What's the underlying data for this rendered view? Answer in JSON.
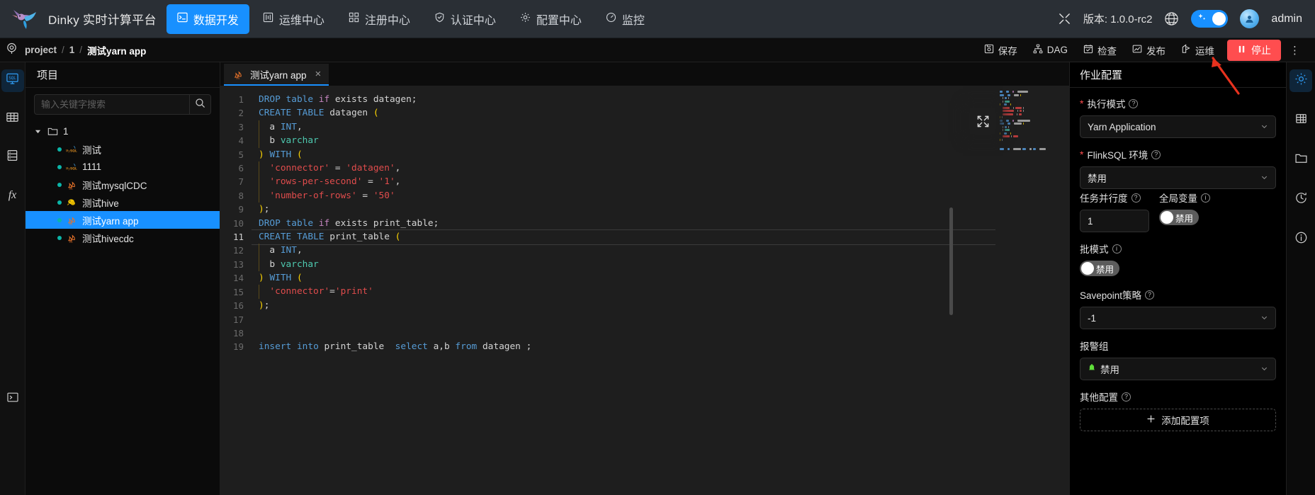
{
  "topnav": {
    "brand": "Dinky 实时计算平台",
    "items": [
      {
        "label": "数据开发",
        "icon": "sql-terminal-icon",
        "active": true
      },
      {
        "label": "运维中心",
        "icon": "ops-icon",
        "active": false
      },
      {
        "label": "注册中心",
        "icon": "registry-icon",
        "active": false
      },
      {
        "label": "认证中心",
        "icon": "auth-shield-icon",
        "active": false
      },
      {
        "label": "配置中心",
        "icon": "gear-icon",
        "active": false
      },
      {
        "label": "监控",
        "icon": "monitor-gauge-icon",
        "active": false
      }
    ],
    "expand_icon": "fullscreen-icon",
    "version": "版本: 1.0.0-rc2",
    "globe_icon": "globe-icon",
    "theme_toggle": "theme-toggle",
    "avatar_icon": "user-avatar",
    "username": "admin"
  },
  "toolbar": {
    "location_icon": "location-pin-icon",
    "breadcrumb": {
      "root": "project",
      "level1": "1",
      "current": "测试yarn app",
      "sep": "/"
    },
    "buttons": [
      {
        "label": "保存",
        "icon": "save-icon"
      },
      {
        "label": "DAG",
        "icon": "dag-icon"
      },
      {
        "label": "检查",
        "icon": "check-icon"
      },
      {
        "label": "发布",
        "icon": "publish-chart-icon"
      },
      {
        "label": "运维",
        "icon": "ops-flag-icon"
      }
    ],
    "stop_label": "停止",
    "stop_icon": "pause-icon",
    "stop_color": "#ff4d4f",
    "more_icon": "more-vertical-icon"
  },
  "left_rail": {
    "items": [
      {
        "icon": "sql-console-icon",
        "active": true
      },
      {
        "icon": "table-grid-icon",
        "active": false
      },
      {
        "icon": "database-icon",
        "active": false
      },
      {
        "icon": "fx-function-icon",
        "active": false
      }
    ],
    "bottom": {
      "icon": "terminal-icon",
      "active": false
    }
  },
  "panel": {
    "title": "项目",
    "search": {
      "placeholder": "输入关键字搜索",
      "value": "",
      "icon": "search-icon"
    },
    "tree": {
      "root": {
        "label": "1",
        "icon": "folder-open-icon",
        "caret": "caret-down-icon"
      },
      "children": [
        {
          "label": "测试",
          "icon": "mysql-icon",
          "selected": false
        },
        {
          "label": "1111",
          "icon": "mysql-icon",
          "selected": false
        },
        {
          "label": "测试mysqlCDC",
          "icon": "flinksql-icon",
          "selected": false
        },
        {
          "label": "测试hive",
          "icon": "hive-icon",
          "selected": false
        },
        {
          "label": "测试yarn app",
          "icon": "flinksql-icon",
          "selected": true
        },
        {
          "label": "测试hivecdc",
          "icon": "flinksql-icon",
          "selected": false
        }
      ]
    }
  },
  "editor": {
    "tab": {
      "label": "测试yarn app",
      "icon": "flinksql-icon",
      "close": "×"
    },
    "current_line": 11,
    "expand_icon": "expand-editor-icon",
    "lines": [
      {
        "n": 1,
        "tokens": [
          {
            "t": "DROP",
            "c": "kw"
          },
          {
            "t": " ",
            "c": "pun"
          },
          {
            "t": "table",
            "c": "kw"
          },
          {
            "t": " ",
            "c": "pun"
          },
          {
            "t": "if",
            "c": "kw2"
          },
          {
            "t": " exists datagen;",
            "c": "id"
          }
        ]
      },
      {
        "n": 2,
        "tokens": [
          {
            "t": "CREATE",
            "c": "kw"
          },
          {
            "t": " ",
            "c": "pun"
          },
          {
            "t": "TABLE",
            "c": "kw"
          },
          {
            "t": " datagen ",
            "c": "id"
          },
          {
            "t": "(",
            "c": "br"
          }
        ]
      },
      {
        "n": 3,
        "tokens": [
          {
            "t": "  a ",
            "c": "id"
          },
          {
            "t": "INT",
            "c": "kw"
          },
          {
            "t": ",",
            "c": "pun"
          }
        ],
        "guide": true
      },
      {
        "n": 4,
        "tokens": [
          {
            "t": "  b ",
            "c": "id"
          },
          {
            "t": "varchar",
            "c": "typ"
          }
        ],
        "guide": true
      },
      {
        "n": 5,
        "tokens": [
          {
            "t": ")",
            "c": "br"
          },
          {
            "t": " ",
            "c": "pun"
          },
          {
            "t": "WITH",
            "c": "kw"
          },
          {
            "t": " ",
            "c": "pun"
          },
          {
            "t": "(",
            "c": "br"
          }
        ]
      },
      {
        "n": 6,
        "tokens": [
          {
            "t": "  ",
            "c": "pun"
          },
          {
            "t": "'connector'",
            "c": "str"
          },
          {
            "t": " = ",
            "c": "op"
          },
          {
            "t": "'datagen'",
            "c": "str"
          },
          {
            "t": ",",
            "c": "pun"
          }
        ],
        "guide": true
      },
      {
        "n": 7,
        "tokens": [
          {
            "t": "  ",
            "c": "pun"
          },
          {
            "t": "'rows-per-second'",
            "c": "str"
          },
          {
            "t": " = ",
            "c": "op"
          },
          {
            "t": "'1'",
            "c": "str"
          },
          {
            "t": ",",
            "c": "pun"
          }
        ],
        "guide": true
      },
      {
        "n": 8,
        "tokens": [
          {
            "t": "  ",
            "c": "pun"
          },
          {
            "t": "'number-of-rows'",
            "c": "str"
          },
          {
            "t": " = ",
            "c": "op"
          },
          {
            "t": "'50'",
            "c": "str"
          }
        ],
        "guide": true
      },
      {
        "n": 9,
        "tokens": [
          {
            "t": ")",
            "c": "br"
          },
          {
            "t": ";",
            "c": "pun"
          }
        ]
      },
      {
        "n": 10,
        "tokens": [
          {
            "t": "DROP",
            "c": "kw"
          },
          {
            "t": " ",
            "c": "pun"
          },
          {
            "t": "table",
            "c": "kw"
          },
          {
            "t": " ",
            "c": "pun"
          },
          {
            "t": "if",
            "c": "kw2"
          },
          {
            "t": " exists print_table;",
            "c": "id"
          }
        ]
      },
      {
        "n": 11,
        "tokens": [
          {
            "t": "CREATE",
            "c": "kw"
          },
          {
            "t": " ",
            "c": "pun"
          },
          {
            "t": "TABLE",
            "c": "kw"
          },
          {
            "t": " print_table ",
            "c": "id"
          },
          {
            "t": "(",
            "c": "br"
          }
        ]
      },
      {
        "n": 12,
        "tokens": [
          {
            "t": "  a ",
            "c": "id"
          },
          {
            "t": "INT",
            "c": "kw"
          },
          {
            "t": ",",
            "c": "pun"
          }
        ],
        "guide": true
      },
      {
        "n": 13,
        "tokens": [
          {
            "t": "  b ",
            "c": "id"
          },
          {
            "t": "varchar",
            "c": "typ"
          }
        ],
        "guide": true
      },
      {
        "n": 14,
        "tokens": [
          {
            "t": ")",
            "c": "br"
          },
          {
            "t": " ",
            "c": "pun"
          },
          {
            "t": "WITH",
            "c": "kw"
          },
          {
            "t": " ",
            "c": "pun"
          },
          {
            "t": "(",
            "c": "br"
          }
        ]
      },
      {
        "n": 15,
        "tokens": [
          {
            "t": "  ",
            "c": "pun"
          },
          {
            "t": "'connector'",
            "c": "str"
          },
          {
            "t": "=",
            "c": "op"
          },
          {
            "t": "'print'",
            "c": "str"
          }
        ],
        "guide": true
      },
      {
        "n": 16,
        "tokens": [
          {
            "t": ")",
            "c": "br"
          },
          {
            "t": ";",
            "c": "pun"
          }
        ]
      },
      {
        "n": 17,
        "tokens": []
      },
      {
        "n": 18,
        "tokens": []
      },
      {
        "n": 19,
        "tokens": [
          {
            "t": "insert",
            "c": "kw"
          },
          {
            "t": " ",
            "c": "pun"
          },
          {
            "t": "into",
            "c": "kw"
          },
          {
            "t": " print_table  ",
            "c": "id"
          },
          {
            "t": "select",
            "c": "kw"
          },
          {
            "t": " a,b ",
            "c": "id"
          },
          {
            "t": "from",
            "c": "kw"
          },
          {
            "t": " datagen ;",
            "c": "id"
          }
        ]
      }
    ]
  },
  "config": {
    "title": "作业配置",
    "fields": {
      "exec_mode": {
        "label": "执行模式",
        "required": true,
        "value": "Yarn Application",
        "help": "?"
      },
      "flinksql_env": {
        "label": "FlinkSQL 环境",
        "required": true,
        "value": "禁用",
        "help": "?"
      },
      "parallelism": {
        "label": "任务并行度",
        "value": "1",
        "help": "?"
      },
      "global_var": {
        "label": "全局变量",
        "value": "禁用",
        "help": "i"
      },
      "batch_mode": {
        "label": "批模式",
        "value": "禁用",
        "help": "i"
      },
      "savepoint": {
        "label": "Savepoint策略",
        "value": "-1",
        "help": "?"
      },
      "alarm_group": {
        "label": "报警组",
        "value": "禁用"
      },
      "other_config": {
        "label": "其他配置",
        "help": "?",
        "add_label": "添加配置项",
        "add_icon": "plus-icon"
      }
    }
  },
  "config_rail": {
    "items": [
      {
        "icon": "gear-icon",
        "active": true
      },
      {
        "icon": "table-grid-icon",
        "active": false
      },
      {
        "icon": "folder-icon",
        "active": false
      },
      {
        "icon": "history-clock-icon",
        "active": false
      },
      {
        "icon": "info-circle-icon",
        "active": false
      }
    ]
  },
  "annotation": {
    "arrow_icon": "red-arrow-annotation",
    "color": "#e8321e"
  }
}
